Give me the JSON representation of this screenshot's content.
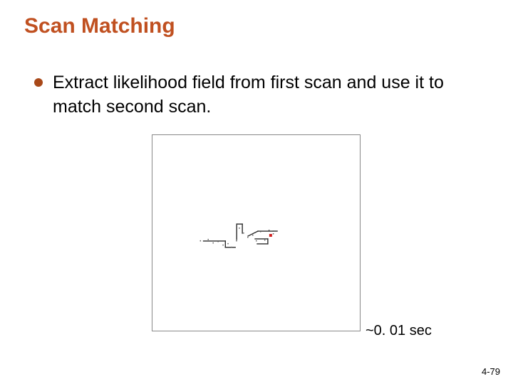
{
  "title": "Scan Matching",
  "bullet": "Extract likelihood field from first scan and use it to match second scan.",
  "caption": "~0. 01 sec",
  "page_number": "4-79"
}
